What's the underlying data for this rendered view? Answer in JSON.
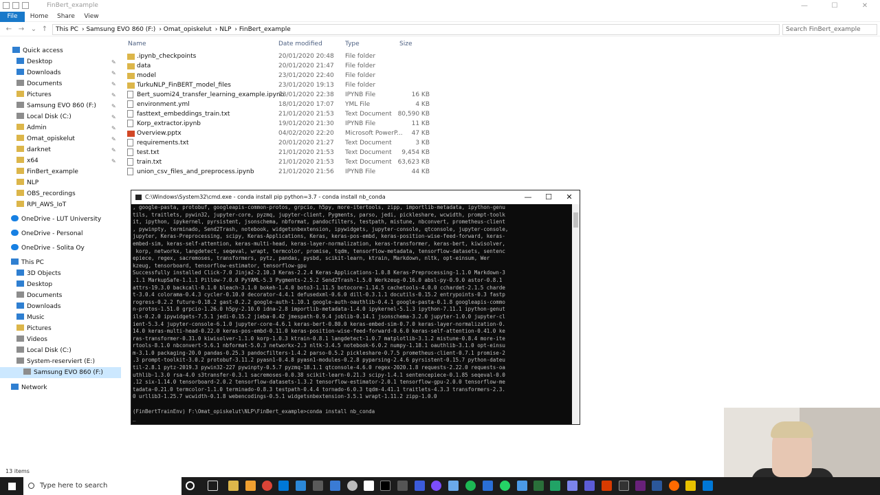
{
  "window": {
    "title": "FinBert_example",
    "controls": {
      "minimize": "—",
      "maximize": "☐",
      "close": "✕"
    }
  },
  "ribbon": {
    "tabs": [
      "File",
      "Home",
      "Share",
      "View"
    ]
  },
  "address": {
    "crumbs": [
      "This PC",
      "Samsung EVO 860 (F:)",
      "Omat_opiskelut",
      "NLP",
      "FinBert_example"
    ],
    "search_placeholder": "Search FinBert_example"
  },
  "nav_pane": {
    "quick_access": "Quick access",
    "quick_items": [
      "Desktop",
      "Downloads",
      "Documents",
      "Pictures",
      "Samsung EVO 860 (F:)",
      "Local Disk (C:)",
      "Admin",
      "Omat_opiskelut",
      "darknet",
      "x64",
      "FinBert_example",
      "NLP",
      "OBS_recordings",
      "RPI_AWS_IoT"
    ],
    "onedrive": [
      "OneDrive - LUT University",
      "OneDrive - Personal",
      "OneDrive - Solita Oy"
    ],
    "this_pc": "This PC",
    "pc_items": [
      "3D Objects",
      "Desktop",
      "Documents",
      "Downloads",
      "Music",
      "Pictures",
      "Videos",
      "Local Disk (C:)",
      "System-reserviert (E:)",
      "Samsung EVO 860 (F:)"
    ],
    "network": "Network"
  },
  "columns": {
    "name": "Name",
    "date": "Date modified",
    "type": "Type",
    "size": "Size"
  },
  "files": [
    {
      "name": ".ipynb_checkpoints",
      "date": "20/01/2020 20:48",
      "type": "File folder",
      "size": ""
    },
    {
      "name": "data",
      "date": "20/01/2020 21:47",
      "type": "File folder",
      "size": ""
    },
    {
      "name": "model",
      "date": "23/01/2020 22:40",
      "type": "File folder",
      "size": ""
    },
    {
      "name": "TurkuNLP_FinBERT_model_files",
      "date": "23/01/2020 19:13",
      "type": "File folder",
      "size": ""
    },
    {
      "name": "Bert_suomi24_transfer_learning_example.ipynb",
      "date": "23/01/2020 22:38",
      "type": "IPYNB File",
      "size": "16 KB"
    },
    {
      "name": "environment.yml",
      "date": "18/01/2020 17:07",
      "type": "YML File",
      "size": "4 KB"
    },
    {
      "name": "fasttext_embeddings_train.txt",
      "date": "21/01/2020 21:53",
      "type": "Text Document",
      "size": "80,590 KB"
    },
    {
      "name": "Korp_extractor.ipynb",
      "date": "19/01/2020 21:30",
      "type": "IPYNB File",
      "size": "11 KB"
    },
    {
      "name": "Overview.pptx",
      "date": "04/02/2020 22:20",
      "type": "Microsoft PowerP...",
      "size": "47 KB"
    },
    {
      "name": "requirements.txt",
      "date": "20/01/2020 21:27",
      "type": "Text Document",
      "size": "3 KB"
    },
    {
      "name": "test.txt",
      "date": "21/01/2020 21:53",
      "type": "Text Document",
      "size": "9,454 KB"
    },
    {
      "name": "train.txt",
      "date": "21/01/2020 21:53",
      "type": "Text Document",
      "size": "63,623 KB"
    },
    {
      "name": "union_csv_files_and_preprocess.ipynb",
      "date": "21/01/2020 21:56",
      "type": "IPYNB File",
      "size": "44 KB"
    }
  ],
  "status": {
    "items_count": "13 items"
  },
  "cmd": {
    "title": "C:\\Windows\\System32\\cmd.exe - conda  install pip python=3.7 - conda  install nb_conda",
    "lines": [
      ", google-pasta, protobuf, googleapis-common-protos, grpcio, h5py, more-itertools, zipp, importlib-metadata, ipython-genu",
      "tils, traitlets, pywin32, jupyter-core, pyzmq, jupyter-client, Pygments, parso, jedi, pickleshare, wcwidth, prompt-toolk",
      "it, ipython, ipykernel, pyrsistent, jsonschema, nbformat, pandocfilters, testpath, mistune, nbconvert, prometheus-client",
      ", pywinpty, terminado, Send2Trash, notebook, widgetsnbextension, ipywidgets, jupyter-console, qtconsole, jupyter-console,",
      "jupyter, Keras-Preprocessing, scipy, Keras-Applications, Keras, keras-pos-embd, keras-position-wise-feed-forward, keras-",
      "embed-sim, keras-self-attention, keras-multi-head, keras-layer-normalization, keras-transformer, keras-bert, kiwisolver,",
      " korp, networkx, langdetect, seqeval, wrapt, termcolor, promise, tqdm, tensorflow-metadata, tensorflow-datasets, sentenc",
      "epiece, regex, sacremoses, transformers, pytz, pandas, pysbd, scikit-learn, ktrain, Markdown, nltk, opt-einsum, Wer",
      "kzeug, tensorboard, tensorflow-estimator, tensorflow-gpu",
      "Successfully installed Click-7.0 Jinja2-2.10.3 Keras-2.2.4 Keras-Applications-1.0.8 Keras-Preprocessing-1.1.0 Markdown-3",
      ".1.1 MarkupSafe-1.1.1 Pillow-7.0.0 PyYAML-5.3 Pygments-2.5.2 Send2Trash-1.5.0 Werkzeug-0.16.0 absl-py-0.9.0 astor-0.8.1",
      "attrs-19.3.0 backcall-0.1.0 bleach-3.1.0 bokeh-1.4.0 boto3-1.11.5 botocore-1.14.5 cachetools-4.0.0 cchardet-2.1.5 charde",
      "t-3.0.4 colorama-0.4.3 cycler-0.10.0 decorator-4.4.1 defusedxml-0.6.0 dill-0.3.1.1 docutils-0.15.2 entrypoints-0.3 fastp",
      "rogress-0.2.2 future-0.18.2 gast-0.2.2 google-auth-1.10.1 google-auth-oauthlib-0.4.1 google-pasta-0.1.8 googleapis-commo",
      "n-protos-1.51.0 grpcio-1.26.0 h5py-2.10.0 idna-2.8 importlib-metadata-1.4.0 ipykernel-5.1.3 ipython-7.11.1 ipython-genut",
      "ils-0.2.0 ipywidgets-7.5.1 jedi-0.15.2 jieba-0.42 jmespath-0.9.4 joblib-0.14.1 jsonschema-3.2.0 jupyter-1.0.0 jupyter-cl",
      "ient-5.3.4 jupyter-console-6.1.0 jupyter-core-4.6.1 keras-bert-0.80.0 keras-embed-sim-0.7.0 keras-layer-normalization-0.",
      "14.0 keras-multi-head-0.22.0 keras-pos-embd-0.11.0 keras-position-wise-feed-forward-0.6.0 keras-self-attention-0.41.0 ke",
      "ras-transformer-0.31.0 kiwisolver-1.1.0 korp-1.0.3 ktrain-0.8.1 langdetect-1.0.7 matplotlib-3.1.2 mistune-0.8.4 more-ite",
      "rtools-8.1.0 nbconvert-5.6.1 nbformat-5.0.3 networkx-2.3 nltk-3.4.5 notebook-6.0.2 numpy-1.18.1 oauthlib-3.1.0 opt-einsu",
      "m-3.1.0 packaging-20.0 pandas-0.25.3 pandocfilters-1.4.2 parso-0.5.2 pickleshare-0.7.5 prometheus-client-0.7.1 promise-2",
      ".3 prompt-toolkit-3.0.2 protobuf-3.11.2 pyasn1-0.4.8 pyasn1-modules-0.2.8 pyparsing-2.4.6 pyrsistent-0.15.7 python-dateu",
      "til-2.8.1 pytz-2019.3 pywin32-227 pywinpty-0.5.7 pyzmq-18.1.1 qtconsole-4.6.0 regex-2020.1.8 requests-2.22.0 requests-oa",
      "uthlib-1.3.0 rsa-4.0 s3transfer-0.3.1 sacremoses-0.0.38 scikit-learn-0.21.3 scipy-1.4.1 sentencepiece-0.1.85 seqeval-0.0",
      ".12 six-1.14.0 tensorboard-2.0.2 tensorflow-datasets-1.3.2 tensorflow-estimator-2.0.1 tensorflow-gpu-2.0.0 tensorflow-me",
      "tadata-0.21.0 termcolor-1.1.0 terminado-0.8.3 testpath-0.4.4 tornado-6.0.3 tqdm-4.41.1 traitlets-4.3.3 transformers-2.3.",
      "0 urllib3-1.25.7 wcwidth-0.1.8 webencodings-0.5.1 widgetsnbextension-3.5.1 wrapt-1.11.2 zipp-1.0.0",
      "",
      "(FinBertTrainEnv) F:\\Omat_opiskelut\\NLP\\FinBert_example>conda install nb_conda",
      "_"
    ]
  },
  "taskbar": {
    "search_placeholder": "Type here to search"
  },
  "colors": {
    "accent": "#1979ca",
    "folder": "#dcb64a",
    "selection": "#cce8ff",
    "taskbar": "#1c1c1c",
    "console_bg": "#0c0c0c",
    "console_fg": "#c0c0c0"
  }
}
